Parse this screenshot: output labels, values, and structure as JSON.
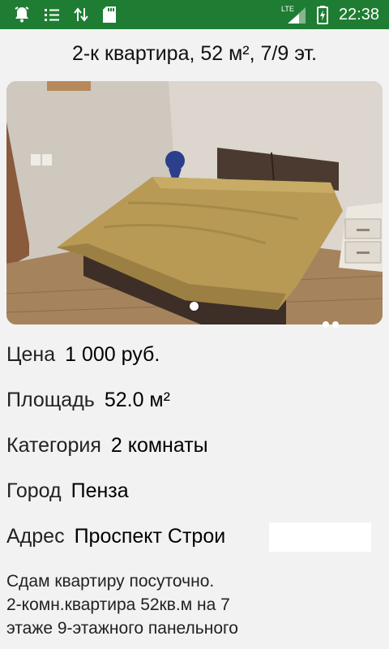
{
  "status_bar": {
    "time": "22:38",
    "network_label": "LTE",
    "icons": [
      "alarm-bell-icon",
      "list-icon",
      "data-transfer-icon",
      "sd-card-icon",
      "lte-signal-icon",
      "battery-charging-icon"
    ],
    "background": "#1e7d32"
  },
  "listing": {
    "title": "2-к квартира, 52 м², 7/9 эт.",
    "photo": {
      "page_index": 1,
      "page_count": 3
    },
    "fields": [
      {
        "label": "Цена",
        "value": "1 000 руб."
      },
      {
        "label": "Площадь",
        "value": "52.0 м²"
      },
      {
        "label": "Категория",
        "value": "2 комнаты"
      },
      {
        "label": "Город",
        "value": "Пенза"
      },
      {
        "label": "Адрес",
        "value": "Проспект Строи"
      }
    ],
    "description_lines": [
      "Сдам квартиру посуточно.",
      "2-комн.квартира 52кв.м на 7",
      "этаже 9-этажного панельного"
    ]
  }
}
